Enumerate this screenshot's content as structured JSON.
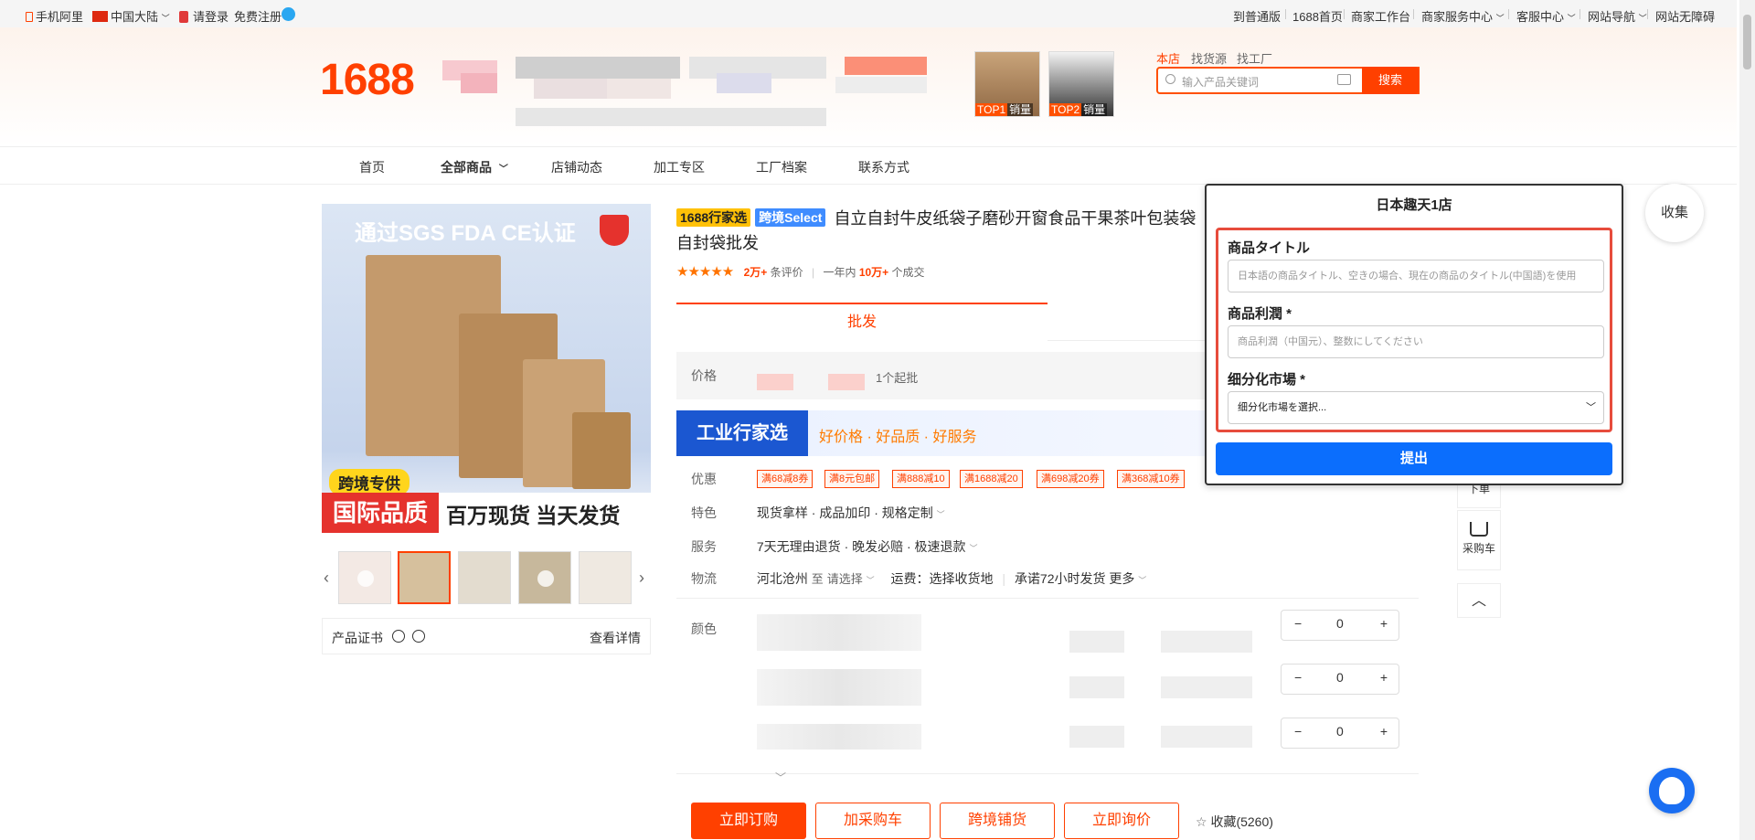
{
  "topbar": {
    "mobile": "手机阿里",
    "region": "中国大陆",
    "login": "请登录",
    "register": "免费注册",
    "right_links": [
      "到普通版",
      "1688首页",
      "商家工作台",
      "商家服务中心",
      "客服中心",
      "网站导航",
      "网站无障碍"
    ]
  },
  "header": {
    "logo": "1688",
    "rank1": "TOP1",
    "rank1_suffix": "销量",
    "rank2": "TOP2",
    "rank2_suffix": "销量",
    "search_tabs": [
      "本店",
      "找货源",
      "找工厂"
    ],
    "search_placeholder": "输入产品关键词",
    "search_button": "搜索"
  },
  "nav": [
    "首页",
    "全部商品",
    "店铺动态",
    "加工专区",
    "工厂档案",
    "联系方式"
  ],
  "gallery": {
    "banner_top": "通过SGS FDA CE认证",
    "badge": "跨境专供",
    "banner_left": "国际品质",
    "banner_right": "百万现货 当天发货",
    "cert_label": "产品证书",
    "cert_link": "查看详情"
  },
  "product": {
    "badge1": "1688行家选",
    "badge2": "跨境Select",
    "title_line1": "自立自封牛皮纸袋子磨砂开窗食品干果茶叶包装袋",
    "title_line2": "自封袋批发",
    "reviews_count": "2万+",
    "reviews_label": "条评价",
    "sales_prefix": "一年内",
    "sales_count": "10万+",
    "sales_suffix": "个成交",
    "tab_wholesale": "批发",
    "price_label": "价格",
    "moq": "1个起批",
    "banner_title": "工业行家选",
    "banner_slogan": "好价格 · 好品质 · 好服务",
    "discount_label": "优惠",
    "discount_tags": [
      "满68减8券",
      "满8元包邮",
      "满888减10",
      "满1688减20",
      "满698减20券",
      "满368减10券"
    ],
    "feature_label": "特色",
    "feature_value": "现货拿样 · 成品加印 · 规格定制",
    "service_label": "服务",
    "service_value": "7天无理由退货 · 晚发必赔 · 极速退款",
    "logistics_label": "物流",
    "logistics_from": "河北沧州",
    "logistics_to_prefix": "至",
    "logistics_to": "请选择",
    "logistics_fee": "运费：选择收货地",
    "logistics_ship": "承诺72小时发货",
    "logistics_more": "更多",
    "color_label": "颜色",
    "qty_values": [
      "0",
      "0",
      "0"
    ]
  },
  "actions": {
    "buy_now": "立即订购",
    "add_cart": "加采购车",
    "cross_border": "跨境铺货",
    "inquiry": "立即询价",
    "favorite": "收藏(5260)"
  },
  "sidebar": {
    "collect": "收集",
    "order": "下单",
    "cart": "采购车"
  },
  "overlay": {
    "title": "日本趣天1店",
    "field1_label": "商品タイトル",
    "field1_placeholder": "日本語の商品タイトル、空きの場合、現在の商品のタイトル(中国語)を使用",
    "field2_label": "商品利潤 *",
    "field2_placeholder": "商品利潤（中国元）、整数にしてください",
    "field3_label": "细分化市場 *",
    "field3_value": "细分化市場を選択...",
    "submit": "提出"
  }
}
